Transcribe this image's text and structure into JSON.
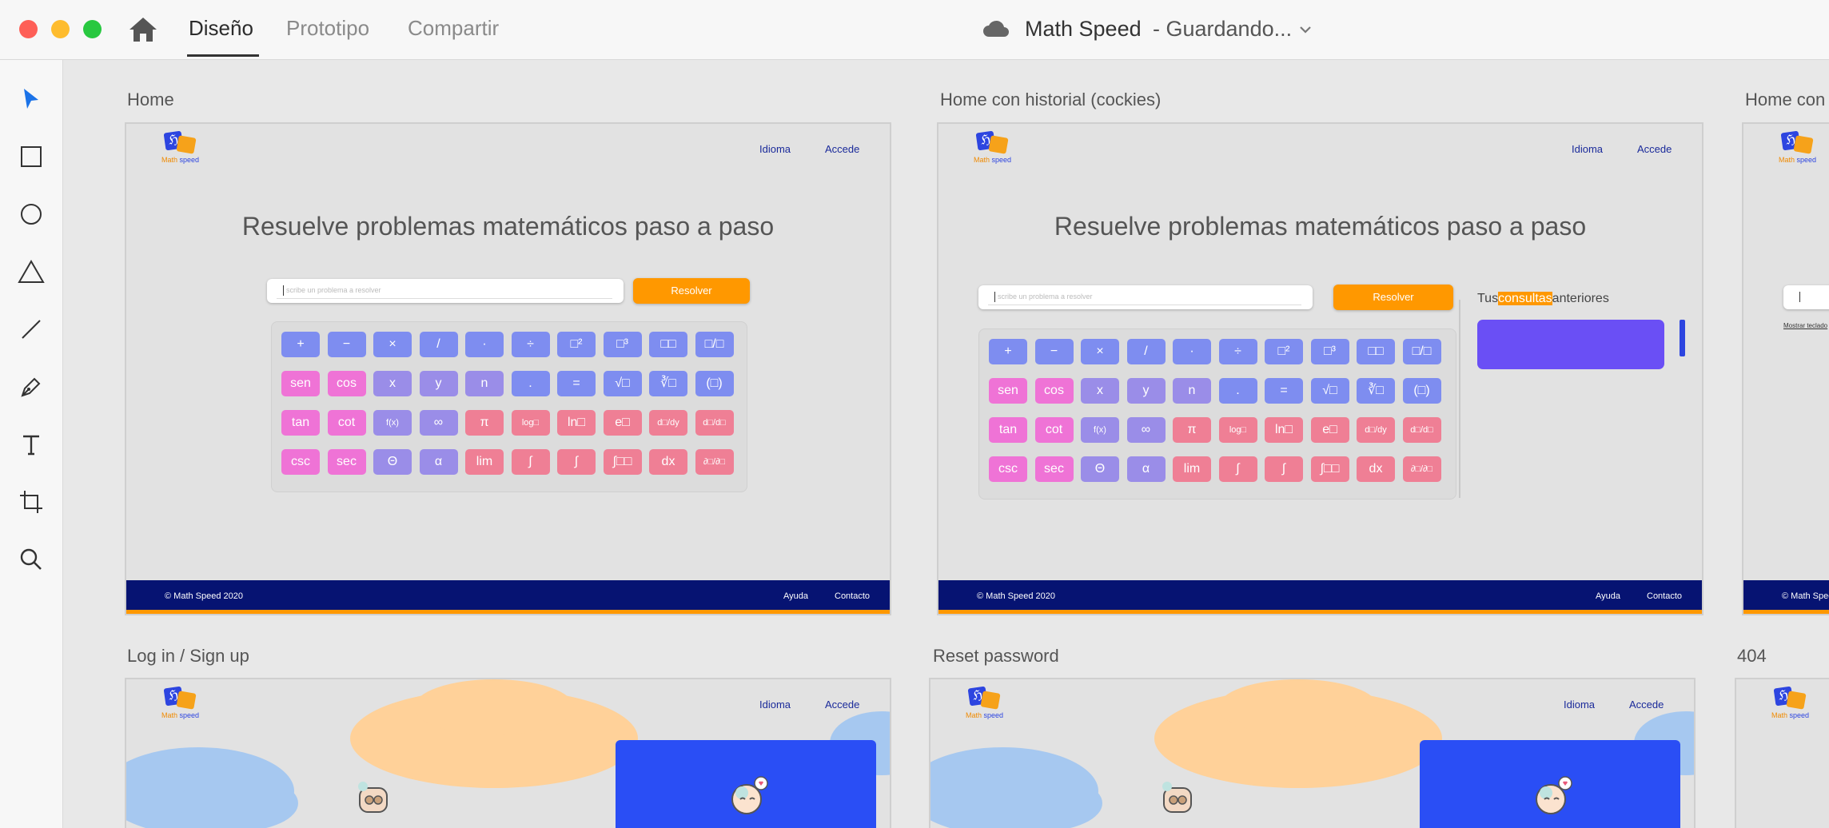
{
  "app": {
    "tabs": [
      "Diseño",
      "Prototipo",
      "Compartir"
    ],
    "document_title": "Math Speed",
    "document_status": "- Guardando...",
    "colors": {
      "close": "#fe5f57",
      "minimize": "#febc2e",
      "maximize": "#28c840",
      "toolbar_active": "#1b73e8"
    }
  },
  "toolbar": {
    "tools": [
      "select-icon",
      "rectangle-icon",
      "ellipse-icon",
      "triangle-icon",
      "line-icon",
      "pen-icon",
      "text-icon",
      "artboard-icon",
      "zoom-icon"
    ]
  },
  "artboards": {
    "home": {
      "label": "Home"
    },
    "home_history": {
      "label": "Home con historial (cockies)"
    },
    "home_partial": {
      "label": "Home con"
    },
    "login": {
      "label": "Log in / Sign up"
    },
    "reset": {
      "label": "Reset password"
    },
    "notfound": {
      "label": "404"
    }
  },
  "site": {
    "logo_math": "Math",
    "logo_speed": "speed",
    "nav_language": "Idioma",
    "nav_login": "Accede",
    "hero": "Resuelve problemas matemáticos paso a paso",
    "search_placeholder": "scribe un problema a resolver",
    "solve_button": "Resolver",
    "footer_copyright": "© Math Speed 2020",
    "footer_help": "Ayuda",
    "footer_contact": "Contacto",
    "history_prefix": "Tus",
    "history_highlight": "consultas",
    "history_suffix": "anteriores",
    "show_keyboard": "Mostrar teclado"
  },
  "keyboard": {
    "rows": [
      [
        "+",
        "−",
        "×",
        "/",
        "·",
        "÷",
        "□²",
        "□³",
        "□□",
        "□/□"
      ],
      [
        "sen",
        "cos",
        "x",
        "y",
        "n",
        ".",
        "=",
        "√□",
        "∛□",
        "(□)"
      ],
      [
        "tan",
        "cot",
        "f(x)",
        "∞",
        "π",
        "log□",
        "ln□",
        "e□",
        "d□/dy",
        "d□/d□"
      ],
      [
        "csc",
        "sec",
        "Θ",
        "α",
        "lim",
        "∫",
        "∫",
        "∫□□",
        "dx",
        "∂□/∂□"
      ]
    ],
    "row_colors": [
      [
        "#7e8df0",
        "#7e8df0",
        "#7e8df0",
        "#7e8df0",
        "#7e8df0",
        "#7e8df0",
        "#7e8df0",
        "#7e8df0",
        "#7e8df0",
        "#7e8df0"
      ],
      [
        "#ef73d6",
        "#ef73d6",
        "#9a8de8",
        "#9a8de8",
        "#9a8de8",
        "#7e8df0",
        "#7e8df0",
        "#7e8df0",
        "#7e8df0",
        "#7e8df0"
      ],
      [
        "#ef73d6",
        "#ef73d6",
        "#9a8de8",
        "#9a8de8",
        "#ef7f95",
        "#ef7f95",
        "#ef7f95",
        "#ef7f95",
        "#ef7f95",
        "#ef7f95"
      ],
      [
        "#ef73d6",
        "#ef73d6",
        "#9a8de8",
        "#9a8de8",
        "#ef7f95",
        "#ef7f95",
        "#ef7f95",
        "#ef7f95",
        "#ef7f95",
        "#ef7f95"
      ]
    ]
  }
}
